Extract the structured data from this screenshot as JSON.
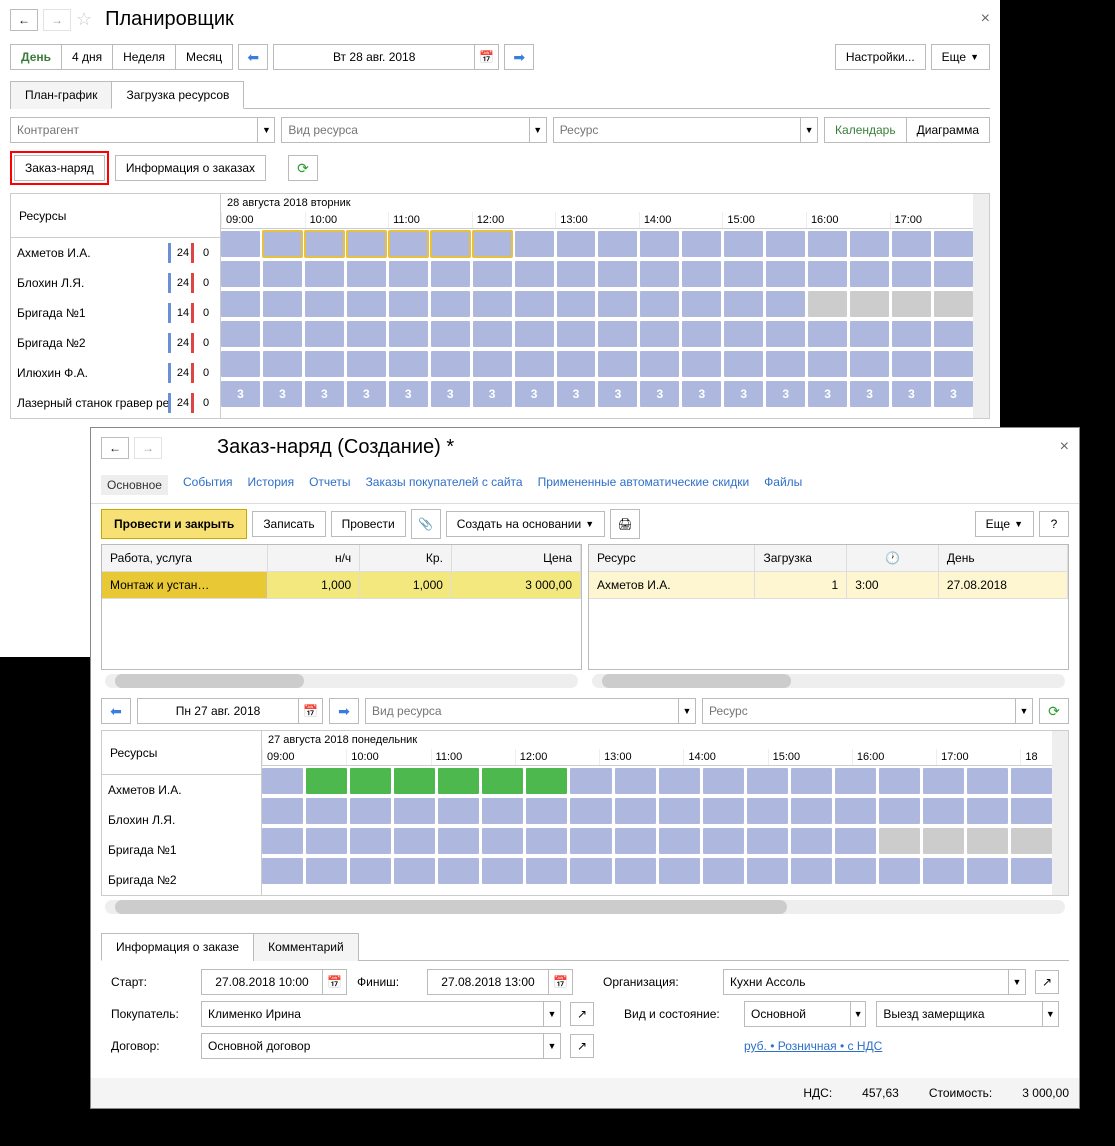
{
  "planner": {
    "title": "Планировщик",
    "views": {
      "day": "День",
      "4days": "4 дня",
      "week": "Неделя",
      "month": "Месяц"
    },
    "date": "Вт 28 авг. 2018",
    "settings": "Настройки...",
    "more": "Еще",
    "tabs": {
      "plan": "План-график",
      "load": "Загрузка ресурсов"
    },
    "filters": {
      "counterparty": "Контрагент",
      "restype": "Вид ресурса",
      "resource": "Ресурс"
    },
    "viewbtns": {
      "calendar": "Календарь",
      "diagram": "Диаграмма"
    },
    "actions": {
      "order": "Заказ-наряд",
      "info": "Информация о заказах"
    },
    "grid": {
      "header": "Ресурсы",
      "date": "28 августа 2018 вторник",
      "hours": [
        "09:00",
        "10:00",
        "11:00",
        "12:00",
        "13:00",
        "14:00",
        "15:00",
        "16:00",
        "17:00"
      ],
      "rows": [
        {
          "name": "Ахметов И.А.",
          "a": "24",
          "b": "0"
        },
        {
          "name": "Блохин Л.Я.",
          "a": "24",
          "b": "0"
        },
        {
          "name": "Бригада №1",
          "a": "14",
          "b": "0"
        },
        {
          "name": "Бригада №2",
          "a": "24",
          "b": "0"
        },
        {
          "name": "Илюхин Ф.А.",
          "a": "24",
          "b": "0"
        },
        {
          "name": "Лазерный станок гравер резчи",
          "a": "24",
          "b": "0"
        }
      ],
      "slot_num": "3"
    }
  },
  "order": {
    "title": "Заказ-наряд (Создание) *",
    "nav": {
      "main": "Основное",
      "events": "События",
      "history": "История",
      "reports": "Отчеты",
      "web": "Заказы покупателей с сайта",
      "discounts": "Примененные автоматические скидки",
      "files": "Файлы"
    },
    "actions": {
      "post_close": "Провести и закрыть",
      "save": "Записать",
      "post": "Провести",
      "create_based": "Создать на основании",
      "more": "Еще",
      "help": "?"
    },
    "table1": {
      "headers": {
        "service": "Работа, услуга",
        "nh": "н/ч",
        "kr": "Кр.",
        "price": "Цена"
      },
      "row": {
        "service": "Монтаж и устан…",
        "nh": "1,000",
        "kr": "1,000",
        "price": "3 000,00"
      }
    },
    "table2": {
      "headers": {
        "resource": "Ресурс",
        "load": "Загрузка",
        "time": "🕐",
        "day": "День"
      },
      "row": {
        "resource": "Ахметов И.А.",
        "load": "1",
        "time": "3:00",
        "day": "27.08.2018"
      }
    },
    "date2": "Пн 27 авг. 2018",
    "filters": {
      "restype": "Вид ресурса",
      "resource": "Ресурс"
    },
    "grid": {
      "header": "Ресурсы",
      "date": "27 августа 2018 понедельник",
      "hours": [
        "09:00",
        "10:00",
        "11:00",
        "12:00",
        "13:00",
        "14:00",
        "15:00",
        "16:00",
        "17:00",
        "18"
      ],
      "rows": [
        {
          "name": "Ахметов И.А."
        },
        {
          "name": "Блохин Л.Я."
        },
        {
          "name": "Бригада №1"
        },
        {
          "name": "Бригада №2"
        }
      ]
    },
    "info_tabs": {
      "info": "Информация о заказе",
      "comment": "Комментарий"
    },
    "form": {
      "start_l": "Старт:",
      "start_v": "27.08.2018 10:00",
      "finish_l": "Финиш:",
      "finish_v": "27.08.2018 13:00",
      "org_l": "Организация:",
      "org_v": "Кухни Ассоль",
      "buyer_l": "Покупатель:",
      "buyer_v": "Клименко Ирина",
      "type_l": "Вид и состояние:",
      "type_v": "Основной",
      "status_v": "Выезд замерщика",
      "contract_l": "Договор:",
      "contract_v": "Основной договор",
      "link": "руб. • Розничная • с НДС"
    },
    "totals": {
      "vat_l": "НДС:",
      "vat_v": "457,63",
      "cost_l": "Стоимость:",
      "cost_v": "3 000,00"
    }
  }
}
